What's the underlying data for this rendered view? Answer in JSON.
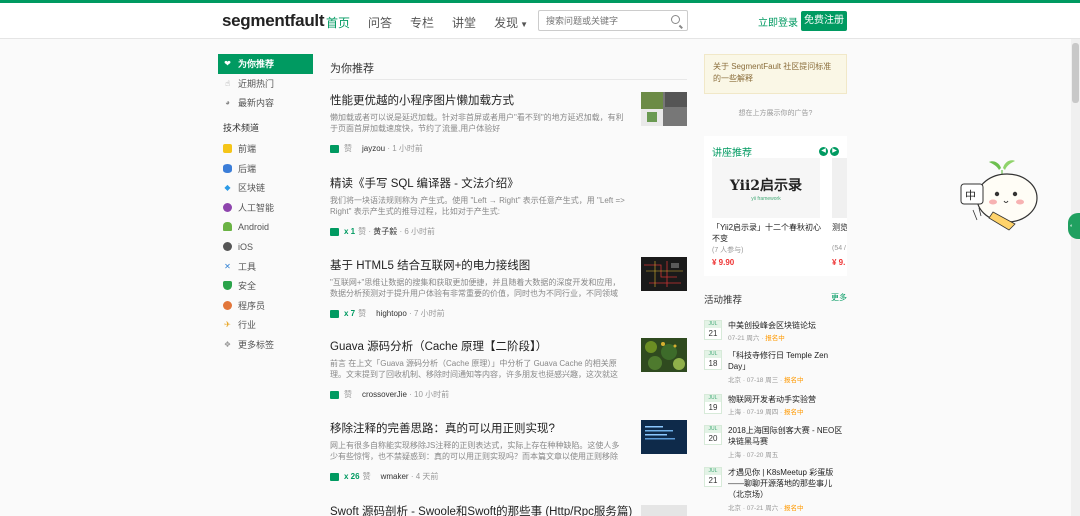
{
  "header": {
    "logo": "segmentfault",
    "nav": [
      {
        "label": "首页",
        "active": true
      },
      {
        "label": "问答"
      },
      {
        "label": "专栏"
      },
      {
        "label": "讲堂"
      },
      {
        "label": "发现"
      }
    ],
    "search_placeholder": "搜索问题或关键字",
    "login_label": "立即登录",
    "register_label": "免费注册"
  },
  "sidebar": {
    "items": [
      {
        "label": "为你推荐",
        "icon": "heart-icon",
        "active": true
      },
      {
        "label": "近期热门",
        "icon": "thumb-icon"
      },
      {
        "label": "最新内容",
        "icon": "globe-icon"
      }
    ],
    "section_title": "技术频道",
    "channels": [
      {
        "label": "前端",
        "icon": "frontend-icon",
        "color": "#f5c518"
      },
      {
        "label": "后端",
        "icon": "database-icon",
        "color": "#3b7dd8"
      },
      {
        "label": "区块链",
        "icon": "blockchain-icon",
        "color": "#2b9ae6"
      },
      {
        "label": "人工智能",
        "icon": "ai-icon",
        "color": "#8e44ad"
      },
      {
        "label": "Android",
        "icon": "android-icon",
        "color": "#6ab344"
      },
      {
        "label": "iOS",
        "icon": "apple-icon",
        "color": "#555555"
      },
      {
        "label": "工具",
        "icon": "tools-icon",
        "color": "#2d7fd3"
      },
      {
        "label": "安全",
        "icon": "shield-icon",
        "color": "#2aa34a"
      },
      {
        "label": "程序员",
        "icon": "programmer-icon",
        "color": "#e2763a"
      },
      {
        "label": "行业",
        "icon": "industry-icon",
        "color": "#e7a21d"
      },
      {
        "label": "更多标签",
        "icon": "tags-icon",
        "color": "#999999"
      }
    ]
  },
  "main": {
    "title": "为你推荐",
    "posts": [
      {
        "title": "性能更优越的小程序图片懒加载方式",
        "excerpt": "懒加载或者可以说是延迟加载。针对非首屏或者用户\"看不到\"的地方延迟加载，有利于页面首屏加载速度快，节约了流量,用户体验好",
        "likes": "",
        "like_label": "赞",
        "author": "jayzou",
        "time": "1 小时前"
      },
      {
        "title": "精读《手写 SQL 编译器 - 文法介绍》",
        "excerpt": "我们将一块语法规则称为 产生式。使用 \"Left → Right\" 表示任意产生式，用 \"Left => Right\" 表示产生式的推导过程，比如对于产生式:",
        "likes": "x 1",
        "like_label": "赞",
        "author": "黄子毅",
        "time": "6 小时前"
      },
      {
        "title": "基于 HTML5 结合互联网+的电力接线图",
        "excerpt": "\"互联网+\"思维让数据的搜集和获取更加便捷，并且随着大数据的深度开发和应用，数据分析预测对于提升用户体验有非常重要的价值，同时也为不同行业，不同领域的合作提供...",
        "likes": "x 7",
        "like_label": "赞",
        "author": "hightopo",
        "time": "7 小时前"
      },
      {
        "title": "Guava 源码分析（Cache 原理【二阶段】）",
        "excerpt": "前言 在上文「Guava 源码分析（Cache 原理）」中分析了 Guava Cache 的相关原理。文末提到了回收机制、移除时间通知等内容，许多朋友也挺感兴趣，这次就这两个内容再来...",
        "likes": "",
        "like_label": "赞",
        "author": "crossoverJie",
        "time": "10 小时前"
      },
      {
        "title": "移除注释的完善思路：真的可以用正则实现?",
        "excerpt": "网上有很多自称能实现移除JS注释的正则表达式，实际上存在种种缺陷。这使人多少有些惊愕，也不禁疑惑到：真的可以用正则实现吗？而本篇文章以使用正则移除JS注释为目标，...",
        "likes": "x 26",
        "like_label": "赞",
        "author": "wmaker",
        "time": "4 天前"
      },
      {
        "title": "Swoft 源码剖析 - Swoole和Swoft的那些事 (Http/Rpc服务篇)"
      }
    ]
  },
  "right": {
    "notice": "关于 SegmentFault 社区提问标准的一些解释",
    "ad_text": "想在上方展示你的广告?",
    "courses_title": "讲座推荐",
    "courses": [
      {
        "banner_main": "Yii2启示录",
        "banner_sub": "yii framework",
        "name": "「Yii2启示录」十二个春秋初心不变",
        "people": "(7 人参与)",
        "price": "¥ 9.90"
      },
      {
        "name": "测览优化",
        "people": "(54 /",
        "price": "¥ 9."
      }
    ],
    "activities_title": "活动推荐",
    "activities_more": "更多",
    "activities": [
      {
        "month": "JUL",
        "day": "21",
        "title": "中美创投峰会区块链论坛",
        "date": "07-21 周六",
        "city": "",
        "status": "报名中"
      },
      {
        "month": "JUL",
        "day": "18",
        "title": "「科技寺修行日 Temple Zen Day」",
        "date": "07-18 周三",
        "city": "北京",
        "status": "报名中"
      },
      {
        "month": "JUL",
        "day": "19",
        "title": "物联网开发者动手实验营",
        "date": "07-19 周四",
        "city": "上海",
        "status": "报名中"
      },
      {
        "month": "JUL",
        "day": "20",
        "title": "2018上海国际创客大赛 - NEO区块链黑马赛",
        "date": "07-20 周五",
        "city": "上海",
        "status": ""
      },
      {
        "month": "JUL",
        "day": "21",
        "title": "才遇见你 | K8sMeetup 彩蛋版——聊聊开源落地的那些事儿（北京场）",
        "date": "07-21 周六",
        "city": "北京",
        "status": "报名中"
      }
    ]
  },
  "mascot_text": "中"
}
